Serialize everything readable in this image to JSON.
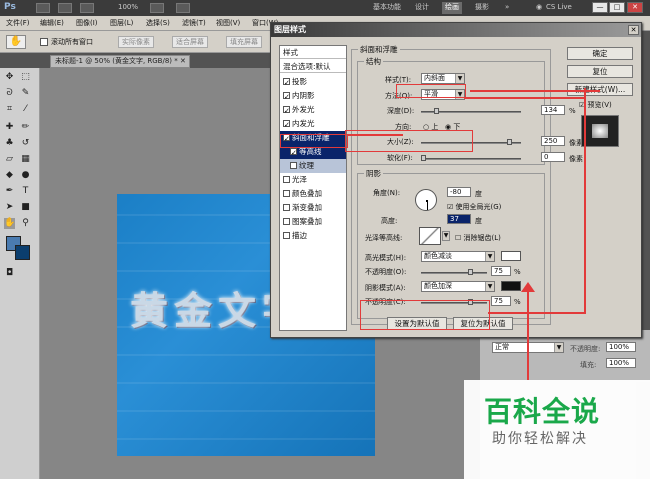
{
  "titlebar": {
    "logo": "Ps",
    "zoom": "100%",
    "workspaces": [
      "基本功能",
      "设计",
      "绘画",
      "摄影"
    ],
    "active_workspace": "绘画",
    "cs_live": "CS Live",
    "more": "»",
    "minimize": "—",
    "restore": "□",
    "close": "✕"
  },
  "menubar": [
    "文件(F)",
    "编辑(E)",
    "图像(I)",
    "图层(L)",
    "选择(S)",
    "滤镜(T)",
    "视图(V)",
    "窗口(W)"
  ],
  "options": {
    "scroll_all": "滚动所有窗口",
    "actual_pixels": "实际像素",
    "fit_screen": "适合屏幕",
    "fill_screen": "填充屏幕"
  },
  "document_tab": "未标题-1 @ 50% (黄金文字, RGB/8) * ✕",
  "canvas_text": "黄金文字",
  "dialog": {
    "title": "图层样式",
    "close": "✕",
    "styles_list": {
      "header": "样式",
      "blend": "混合选项:默认",
      "items": [
        {
          "label": "投影",
          "checked": true
        },
        {
          "label": "内阴影",
          "checked": true
        },
        {
          "label": "外发光",
          "checked": true
        },
        {
          "label": "内发光",
          "checked": true
        },
        {
          "label": "斜面和浮雕",
          "checked": true,
          "selected": true
        },
        {
          "label": "等高线",
          "checked": true,
          "sub": true,
          "selected": true
        },
        {
          "label": "纹理",
          "checked": false,
          "sub": true
        },
        {
          "label": "光泽",
          "checked": false
        },
        {
          "label": "颜色叠加",
          "checked": false
        },
        {
          "label": "渐变叠加",
          "checked": false
        },
        {
          "label": "图案叠加",
          "checked": false
        },
        {
          "label": "描边",
          "checked": false
        }
      ]
    },
    "bevel": {
      "section_title": "斜面和浮雕",
      "structure_title": "结构",
      "style_label": "样式(T):",
      "style_value": "内斜面",
      "method_label": "方法(Q):",
      "method_value": "平滑",
      "depth_label": "深度(D):",
      "depth_value": "134",
      "depth_unit": "%",
      "depth_percent": 13.4,
      "direction_label": "方向:",
      "direction_up": "上",
      "direction_down": "下",
      "size_label": "大小(Z):",
      "size_value": "250",
      "size_unit": "像素",
      "soften_label": "软化(F):",
      "soften_value": "0",
      "soften_unit": "像素",
      "shading_title": "阴影",
      "angle_label": "角度(N):",
      "angle_value": "-80",
      "angle_unit": "度",
      "global_light": "使用全局光(G)",
      "altitude_label": "高度:",
      "altitude_value": "37",
      "altitude_unit": "度",
      "gloss_label": "光泽等高线:",
      "antialias": "消除锯齿(L)",
      "highlight_label": "高光模式(H):",
      "highlight_value": "颜色减淡",
      "highlight_opacity_label": "不透明度(O):",
      "highlight_opacity": "75",
      "highlight_opacity_unit": "%",
      "shadow_label": "阴影模式(A):",
      "shadow_value": "颜色加深",
      "shadow_opacity_label": "不透明度(C):",
      "shadow_opacity": "75",
      "shadow_opacity_unit": "%",
      "highlight_color": "#ffffff",
      "shadow_color": "#111111",
      "make_default": "设置为默认值",
      "reset_default": "复位为默认值"
    },
    "buttons": {
      "ok": "确定",
      "reset": "复位",
      "new_style": "新建样式(W)...",
      "preview": "预览(V)"
    }
  },
  "layers_panel": {
    "mode": "正常",
    "opacity_label": "不透明度:",
    "opacity": "100%",
    "fill_label": "填充:",
    "fill": "100%"
  },
  "watermark": {
    "title": "百科全说",
    "subtitle": "助你轻松解决"
  },
  "colors": {
    "accent_red": "#e23a3a",
    "selection_blue": "#0a246a",
    "watermark_green": "#1aa84a"
  }
}
